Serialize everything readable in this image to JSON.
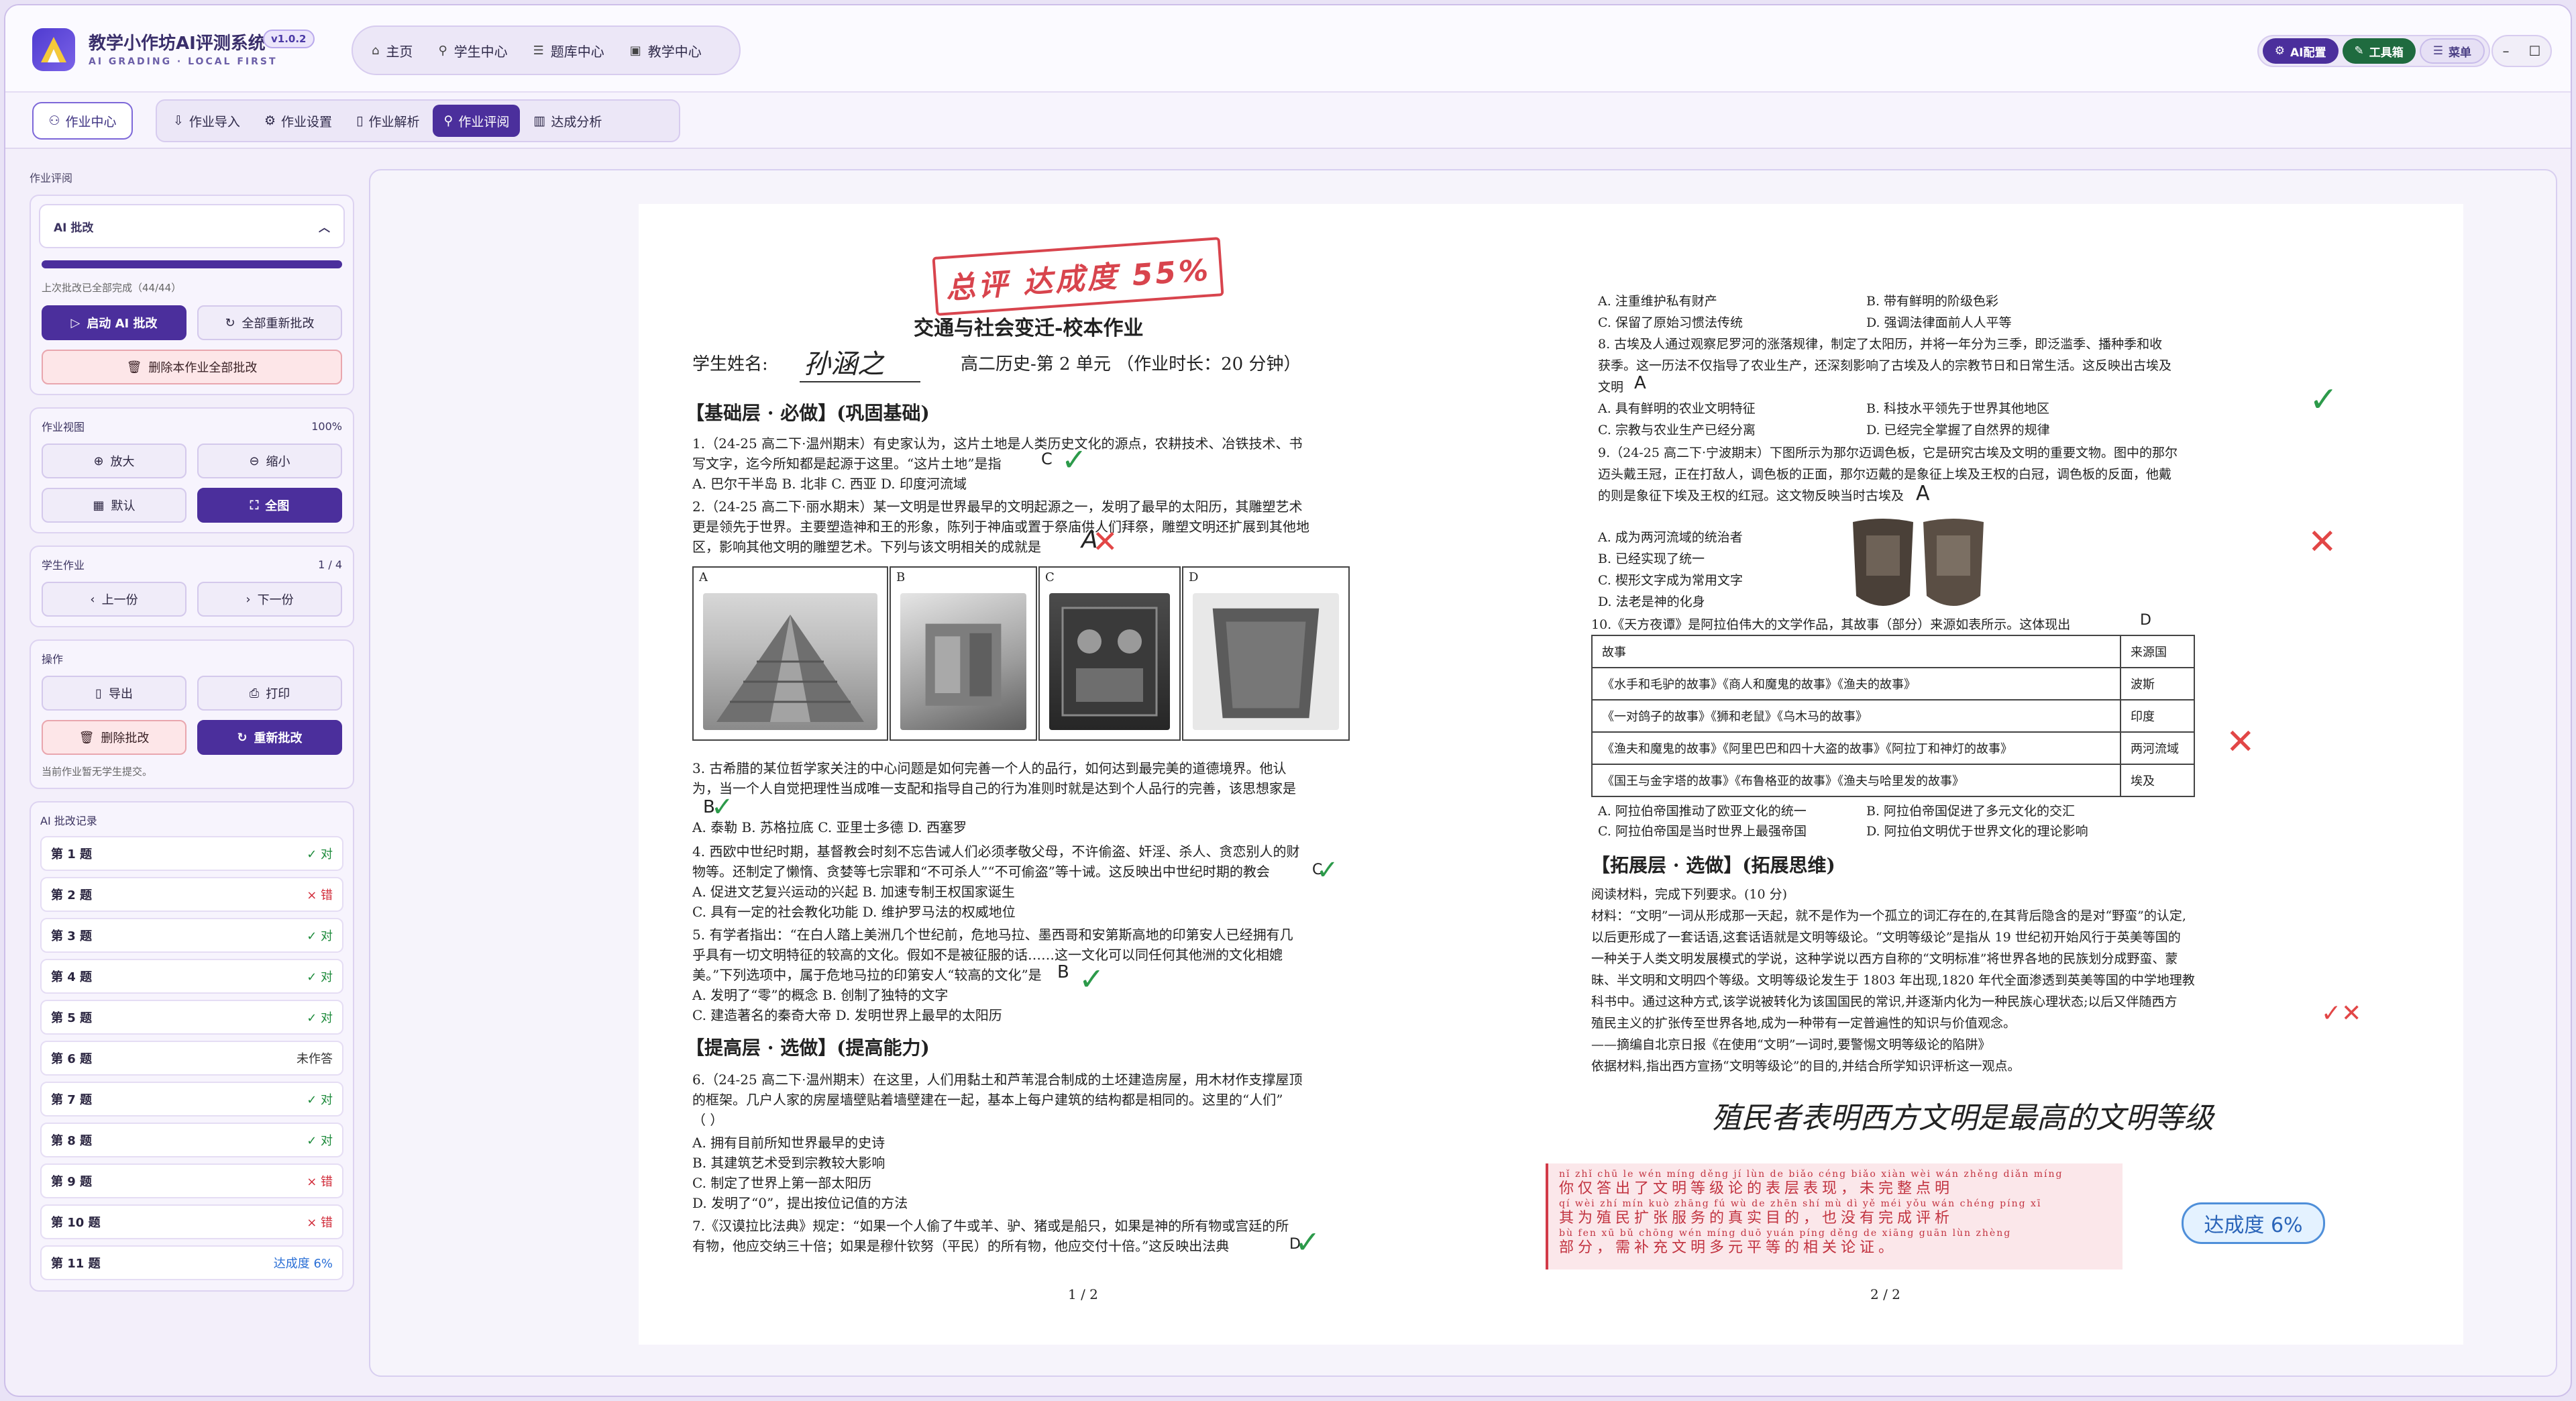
{
  "app": {
    "title": "教学小作坊AI评测系统",
    "version": "v1.0.2",
    "subtitle": "AI GRADING · LOCAL FIRST"
  },
  "nav": [
    {
      "label": "主页",
      "icon": "home-icon"
    },
    {
      "label": "学生中心",
      "icon": "student-icon"
    },
    {
      "label": "题库中心",
      "icon": "bank-icon"
    },
    {
      "label": "教学中心",
      "icon": "teach-icon"
    }
  ],
  "top_right": {
    "ai_config": "AI配置",
    "toolbox": "工具箱",
    "menu": "菜单"
  },
  "subbar": {
    "homework_center": "作业中心",
    "tabs": [
      {
        "label": "作业导入"
      },
      {
        "label": "作业设置"
      },
      {
        "label": "作业解析"
      },
      {
        "label": "作业评阅",
        "active": true
      },
      {
        "label": "达成分析"
      }
    ]
  },
  "sidebar": {
    "section_label": "作业评阅",
    "ai_panel": {
      "title": "AI 批改",
      "progress": 1.0,
      "status": "上次批改已全部完成（44/44）",
      "start_label": "启动 AI 批改",
      "regrade_all_label": "全部重新批改",
      "delete_all_label": "删除本作业全部批改"
    },
    "view": {
      "title": "作业视图",
      "zoom": "100%",
      "zoom_in": "放大",
      "zoom_out": "缩小",
      "default": "默认",
      "fullscreen": "全图"
    },
    "student": {
      "title": "学生作业",
      "counter": "1 / 4",
      "prev": "上一份",
      "next": "下一份"
    },
    "ops": {
      "title": "操作",
      "export": "导出",
      "print": "打印",
      "delete": "删除批改",
      "regrade": "重新批改",
      "note": "当前作业暂无学生提交。"
    },
    "records": {
      "title": "AI 批改记录",
      "items": [
        {
          "q": "第 1 题",
          "status": "✓ 对",
          "kind": "ok"
        },
        {
          "q": "第 2 题",
          "status": "× 错",
          "kind": "bad"
        },
        {
          "q": "第 3 题",
          "status": "✓ 对",
          "kind": "ok"
        },
        {
          "q": "第 4 题",
          "status": "✓ 对",
          "kind": "ok"
        },
        {
          "q": "第 5 题",
          "status": "✓ 对",
          "kind": "ok"
        },
        {
          "q": "第 6 题",
          "status": "未作答",
          "kind": "none"
        },
        {
          "q": "第 7 题",
          "status": "✓ 对",
          "kind": "ok"
        },
        {
          "q": "第 8 题",
          "status": "✓ 对",
          "kind": "ok"
        },
        {
          "q": "第 9 题",
          "status": "× 错",
          "kind": "bad"
        },
        {
          "q": "第 10 题",
          "status": "× 错",
          "kind": "bad"
        },
        {
          "q": "第 11 题",
          "status": "达成度 6%",
          "kind": "rate"
        }
      ]
    }
  },
  "page1": {
    "stamp": "总评 达成度 55%",
    "title": "交通与社会变迁-校本作业",
    "student_label": "学生姓名:",
    "student_name": "孙涵之",
    "unit": "高二历史-第 2 单元 （作业时长：20 分钟）",
    "sec1": "【基础层 · 必做】(巩固基础)",
    "q1_l1": "1.（24-25 高二下·温州期末）有史家认为，这片土地是人类历史文化的源点，农耕技术、冶铁技术、书",
    "q1_l2": "写文字，迄今所知都是起源于这里。“这片土地”是指",
    "q1_ans": "C",
    "q1_opts": "A. 巴尔干半岛 B. 北非 C. 西亚 D. 印度河流域",
    "q2_l1": "2.（24-25 高二下·丽水期末）某一文明是世界最早的文明起源之一，发明了最早的太阳历，其雕塑艺术",
    "q2_l2": "更是领先于世界。主要塑造神和王的形象，陈列于神庙或置于祭庙供人们拜祭，雕塑文明还扩展到其他地",
    "q2_l3": "区，影响其他文明的雕塑艺术。下列与该文明相关的成就是",
    "q2_ans": "A",
    "img_labels": [
      "A",
      "B",
      "C",
      "D"
    ],
    "q3_l1": "3. 古希腊的某位哲学家关注的中心问题是如何完善一个人的品行，如何达到最完美的道德境界。他认",
    "q3_l2": "为，当一个人自觉把理性当成唯一支配和指导自己的行为准则时就是达到个人品行的完善，该思想家是",
    "q3_ans": "B",
    "q3_opts": "A. 泰勒     B. 苏格拉底  C. 亚里士多德     D. 西塞罗",
    "q4_l1": "4. 西欧中世纪时期，基督教会时刻不忘告诫人们必须孝敬父母，不许偷盗、奸淫、杀人、贪恋别人的财",
    "q4_l2": "物等。还制定了懒惰、贪婪等七宗罪和“不可杀人”“不可偷盗”等十诫。这反映出中世纪时期的教会",
    "q4_ans": "C",
    "q4_o1": "A. 促进文艺复兴运动的兴起 B. 加速专制王权国家诞生",
    "q4_o2": "C. 具有一定的社会教化功能  D. 维护罗马法的权威地位",
    "q5_l1": "5. 有学者指出：“在白人踏上美洲几个世纪前，危地马拉、墨西哥和安第斯高地的印第安人已经拥有几",
    "q5_l2": "乎具有一切文明特征的较高的文化。假如不是被征服的话……这一文化可以同任何其他洲的文化相媲",
    "q5_l3": "美。”下列选项中，属于危地马拉的印第安人“较高的文化”是",
    "q5_ans": "B",
    "q5_o1": "A. 发明了“零”的概念         B. 创制了独特的文字",
    "q5_o2": "C. 建造著名的秦奇大帝         D. 发明世界上最早的太阳历",
    "sec2": "【提高层 · 选做】(提高能力)",
    "q6_l1": "6.（24-25 高二下·温州期末）在这里，人们用黏土和芦苇混合制成的土坯建造房屋，用木材作支撑屋顶",
    "q6_l2": "的框架。几户人家的房屋墙壁贴着墙壁建在一起，基本上每户建筑的结构都是相同的。这里的“人们”",
    "q6_l3": "（    ）",
    "q6_o1": "A. 拥有目前所知世界最早的史诗",
    "q6_o2": "B. 其建筑艺术受到宗教较大影响",
    "q6_o3": "C. 制定了世界上第一部太阳历",
    "q6_o4": "D. 发明了“0”，提出按位记值的方法",
    "q7_l1": "7.《汉谟拉比法典》规定：“如果一个人偷了牛或羊、驴、猪或是船只，如果是神的所有物或宫廷的所",
    "q7_l2": "有物，他应交纳三十倍；如果是穆什钦努（平民）的所有物，他应交付十倍。”这反映出法典",
    "q7_ans": "D",
    "page_no": "1 / 2"
  },
  "page2": {
    "q7_o1": "A. 注重维护私有财产",
    "q7_o2": "B. 带有鲜明的阶级色彩",
    "q7_o3": "C. 保留了原始习惯法传统",
    "q7_o4": "D. 强调法律面前人人平等",
    "q8_l1": "8. 古埃及人通过观察尼罗河的涨落规律，制定了太阳历，并将一年分为三季，即泛滥季、播种季和收",
    "q8_l2": "获季。这一历法不仅指导了农业生产，还深刻影响了古埃及人的宗教节日和日常生活。这反映出古埃及",
    "q8_l3": "文明",
    "q8_ans": "A",
    "q8_o1": "A. 具有鲜明的农业文明特征",
    "q8_o2": "B. 科技水平领先于世界其他地区",
    "q8_o3": "C. 宗教与农业生产已经分离",
    "q8_o4": "D. 已经完全掌握了自然界的规律",
    "q9_l1": "9.（24-25 高二下·宁波期末）下图所示为那尔迈调色板，它是研究古埃及文明的重要文物。图中的那尔",
    "q9_l2": "迈头戴王冠，正在打敌人，调色板的正面，那尔迈戴的是象征上埃及王权的白冠，调色板的反面，他戴",
    "q9_l3": "的则是象征下埃及王权的红冠。这文物反映当时古埃及",
    "q9_ans": "A",
    "q9_o1": "A. 成为两河流域的统治者",
    "q9_o2": "B. 已经实现了统一",
    "q9_o3": "C. 楔形文字成为常用文字",
    "q9_o4": "D. 法老是神的化身",
    "q10_l1": "10.《天方夜谭》是阿拉伯伟大的文学作品，其故事（部分）来源如表所示。这体现出",
    "q10_ans": "D",
    "table_head": [
      "故事",
      "来源国"
    ],
    "table_rows": [
      [
        "《水手和毛驴的故事》《商人和魔鬼的故事》《渔夫的故事》",
        "波斯"
      ],
      [
        "《一对鸽子的故事》《狮和老鼠》《乌木马的故事》",
        "印度"
      ],
      [
        "《渔夫和魔鬼的故事》《阿里巴巴和四十大盗的故事》《阿拉丁和神灯的故事》",
        "两河流域"
      ],
      [
        "《国王与金字塔的故事》《布鲁格亚的故事》《渔夫与哈里发的故事》",
        "埃及"
      ]
    ],
    "q10_o1": "A. 阿拉伯帝国推动了欧亚文化的统一",
    "q10_o2": "B. 阿拉伯帝国促进了多元文化的交汇",
    "q10_o3": "C. 阿拉伯帝国是当时世界上最强帝国",
    "q10_o4": "D. 阿拉伯文明优于世界文化的理论影响",
    "sec3": "【拓展层 · 选做】(拓展思维)",
    "q11_intro": "阅读材料，完成下列要求。(10 分)",
    "q11_l1": "材料：“文明”一词从形成那一天起，就不是作为一个孤立的词汇存在的,在其背后隐含的是对“野蛮”的认定,",
    "q11_l2": "以后更形成了一套话语,这套话语就是文明等级论。“文明等级论”是指从 19 世纪初开始风行于英美等国的",
    "q11_l3": "一种关于人类文明发展模式的学说，这种学说以西方自称的“文明标准”将世界各地的民族划分成野蛮、蒙",
    "q11_l4": "昧、半文明和文明四个等级。文明等级论发生于 1803 年出现,1820 年代全面渗透到英美等国的中学地理教",
    "q11_l5": "科书中。通过这种方式,该学说被转化为该国国民的常识,并逐渐内化为一种民族心理状态;以后又伴随西方",
    "q11_l6": "殖民主义的扩张传至世界各地,成为一种带有一定普遍性的知识与价值观念。",
    "q11_l7": "——摘编自北京日报《在使用“文明”一词时,要警惕文明等级论的陷阱》",
    "q11_l8": "依据材料,指出西方宣扬“文明等级论”的目的,并结合所学知识评析这一观点。",
    "q11_answer": "殖民者表明西方文明是最高的文明等级",
    "fb_pinyin1": "nǐ zhǐ chū le wén míng děng jí lùn de biǎo céng biǎo xiàn  wèi wán zhěng diǎn míng",
    "fb_line1": "你仅答出了文明等级论的表层表现，未完整点明",
    "fb_pinyin2": "qí wèi zhí mín kuò zhāng fú wù de zhēn shí mù dì  yě méi yǒu wán chéng píng xī",
    "fb_line2": "其为殖民扩张服务的真实目的，也没有完成评析",
    "fb_pinyin3": "bù fen  xū bǔ chōng wén míng duō yuán píng děng de xiāng guān lùn zhèng",
    "fb_line3": "部分，需补充文明多元平等的相关论证。",
    "rate_badge": "达成度 6%",
    "page_no": "2 / 2"
  },
  "colors": {
    "accent": "#4b2f9c",
    "ok": "#1c8a3a",
    "bad": "#d12c3a",
    "rate": "#2a6fd6"
  }
}
